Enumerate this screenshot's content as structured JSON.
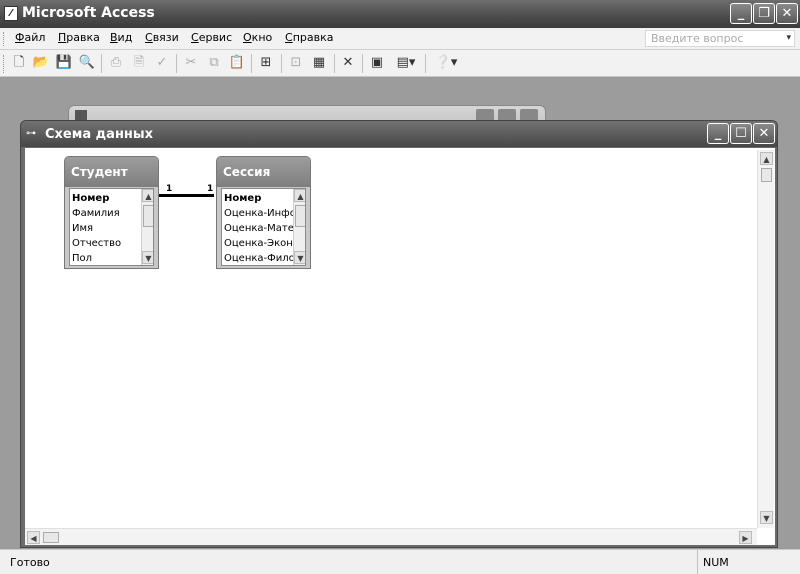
{
  "app": {
    "title": "Microsoft Access",
    "question_placeholder": "Введите вопрос"
  },
  "menu": [
    {
      "accel": "Ф",
      "rest": "айл"
    },
    {
      "accel": "П",
      "rest": "равка"
    },
    {
      "accel": "В",
      "rest": "ид"
    },
    {
      "accel": "С",
      "rest": "вязи"
    },
    {
      "accel": "С",
      "rest": "ервис"
    },
    {
      "accel": "О",
      "rest": "кно"
    },
    {
      "accel": "С",
      "rest": "правка"
    }
  ],
  "icons": {
    "new": "new-file-icon",
    "open": "open-folder-icon",
    "save": "save-icon",
    "search": "file-search-icon",
    "print": "print-icon",
    "preview": "print-preview-icon",
    "spell": "spelling-icon",
    "cut": "cut-icon",
    "copy": "copy-icon",
    "paste": "paste-icon",
    "show_table": "show-table-icon",
    "direct": "direct-relationships-icon",
    "all": "all-relationships-icon",
    "delete": "delete-icon",
    "props": "properties-icon",
    "new_obj": "new-object-icon",
    "help": "help-icon"
  },
  "rel_window": {
    "title": "Схема данных"
  },
  "tables": {
    "student": {
      "title": "Студент",
      "fields": [
        "Номер",
        "Фамилия",
        "Имя",
        "Отчество",
        "Пол"
      ]
    },
    "session": {
      "title": "Сессия",
      "fields": [
        "Номер",
        "Оценка-Информатика",
        "Оценка-Математика",
        "Оценка-Экономика",
        "Оценка-Философия"
      ]
    }
  },
  "relationship": {
    "left_label": "1",
    "right_label": "1"
  },
  "status": {
    "left": "Готово",
    "right": "NUM"
  }
}
